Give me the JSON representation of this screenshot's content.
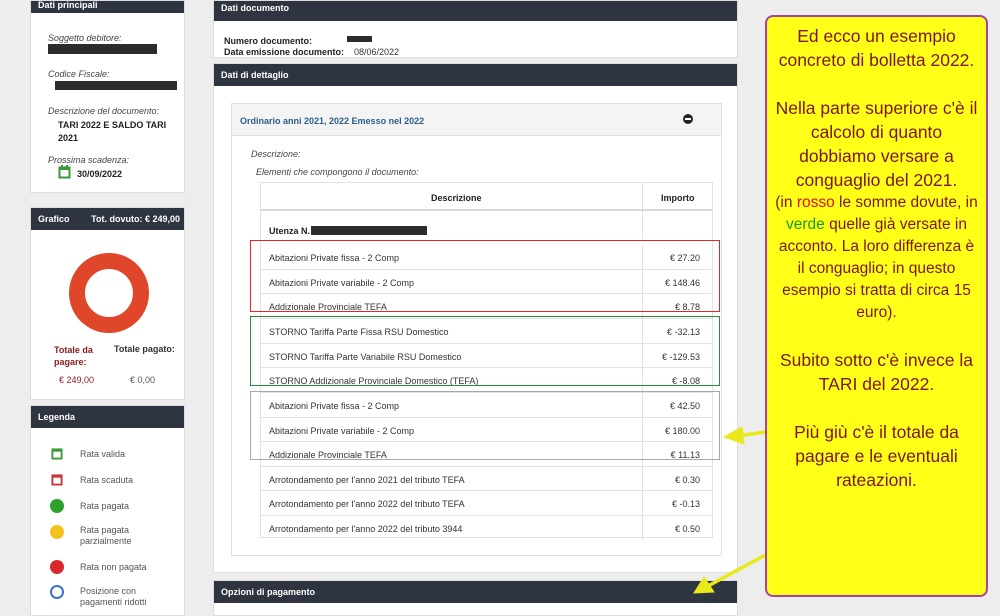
{
  "left": {
    "dati_principali": {
      "title": "Dati principali",
      "soggetto_label": "Soggetto debitore:",
      "codice_label": "Codice Fiscale:",
      "descrizione_label": "Descrizione del documento:",
      "descrizione_value": "TARI 2022 E SALDO TARI 2021",
      "scadenza_label": "Prossima scadenza:",
      "scadenza_value": "30/09/2022"
    },
    "grafico": {
      "title": "Grafico",
      "tot_dovuto": "Tot. dovuto: € 249,00",
      "totale_da_pagare_label": "Totale da pagare:",
      "totale_pagato_label": "Totale pagato:",
      "totale_da_pagare_value": "€ 249,00",
      "totale_pagato_value": "€ 0,00",
      "ring_color": "#e0462a"
    },
    "legenda": {
      "title": "Legenda",
      "items": [
        {
          "label": "Rata valida",
          "icon": "calendar-valid-icon",
          "color": "#3a9a3a"
        },
        {
          "label": "Rata scaduta",
          "icon": "calendar-expired-icon",
          "color": "#c8323a"
        },
        {
          "label": "Rata pagata",
          "icon": "green-dot-icon",
          "color": "#2ea02e"
        },
        {
          "label": "Rata pagata parzialmente",
          "icon": "yellow-dot-icon",
          "color": "#f2c21b"
        },
        {
          "label": "Rata non pagata",
          "icon": "red-dot-icon",
          "color": "#d8282c"
        },
        {
          "label": "Posizione con pagamenti ridotti",
          "icon": "reduced-payment-icon",
          "color": "#3a72c8"
        }
      ]
    }
  },
  "main": {
    "dati_documento": {
      "title": "Dati documento",
      "numero_label": "Numero documento:",
      "emissione_label": "Data emissione documento:",
      "emissione_value": "08/06/2022"
    },
    "dettaglio": {
      "title": "Dati di dettaglio",
      "section_title": "Ordinario anni 2021, 2022 Emesso nel 2022",
      "descrizione_label": "Descrizione:",
      "elementi_label": "Elementi che compongono il documento:",
      "col_descrizione": "Descrizione",
      "col_importo": "Importo",
      "utenza_label": "Utenza N.",
      "rows": [
        {
          "desc": "Abitazioni Private fissa - 2 Comp",
          "amount": "€ 27.20"
        },
        {
          "desc": "Abitazioni Private variabile - 2 Comp",
          "amount": "€ 148.46"
        },
        {
          "desc": "Addizionale Provinciale TEFA",
          "amount": "€ 8.78"
        },
        {
          "desc": "STORNO Tariffa Parte Fissa RSU Domestico",
          "amount": "€ -32.13"
        },
        {
          "desc": "STORNO Tariffa Parte Variabile RSU Domestico",
          "amount": "€ -129.53"
        },
        {
          "desc": "STORNO Addizionale Provinciale Domestico (TEFA)",
          "amount": "€ -8.08"
        },
        {
          "desc": "Abitazioni Private fissa - 2 Comp",
          "amount": "€ 42.50"
        },
        {
          "desc": "Abitazioni Private variabile - 2 Comp",
          "amount": "€ 180.00"
        },
        {
          "desc": "Addizionale Provinciale TEFA",
          "amount": "€ 11.13"
        },
        {
          "desc": "Arrotondamento per l'anno 2021 del tributo TEFA",
          "amount": "€ 0.30"
        },
        {
          "desc": "Arrotondamento per l'anno 2022 del tributo TEFA",
          "amount": "€ -0.13"
        },
        {
          "desc": "Arrotondamento per l'anno 2022 del tributo 3944",
          "amount": "€ 0.50"
        }
      ]
    },
    "opzioni": {
      "title": "Opzioni di pagamento"
    }
  },
  "note": {
    "p1": "Ed ecco un esempio concreto di bolletta 2022.",
    "p2": "Nella parte superiore c'è il calcolo di quanto dobbiamo versare a conguaglio del 2021.",
    "p3a": "(in ",
    "p3_rosso": "rosso",
    "p3b": " le somme dovute, in ",
    "p3_verde": "verde",
    "p3c": " quelle già versate in acconto. La loro differenza è il conguaglio; in questo esempio si tratta di circa 15 euro).",
    "p4": "Subito sotto c'è invece la TARI del 2022.",
    "p5": "Più giù c'è il totale da pagare e le eventuali rateazioni.",
    "colors": {
      "text": "#7a1620",
      "rosso": "#e01010",
      "verde": "#1a9a1a",
      "box": "#ffff18",
      "border": "#a4449e"
    }
  },
  "annotation_colors": {
    "red": "#e0262a",
    "green": "#2a8a3a",
    "gray": "#a8a8a8",
    "arrow": "#e8e81a"
  }
}
